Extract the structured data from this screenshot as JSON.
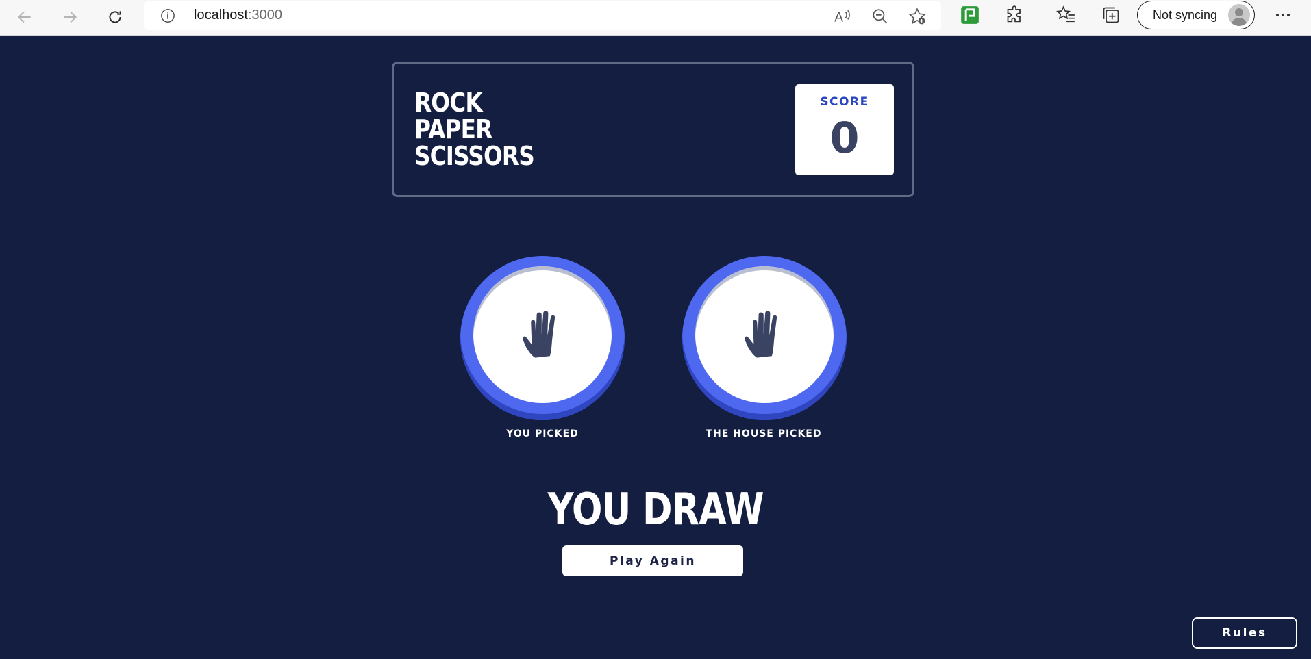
{
  "browser": {
    "url_host": "localhost",
    "url_port": ":3000",
    "profile_label": "Not syncing",
    "icons": [
      "back-arrow-icon",
      "forward-arrow-icon",
      "refresh-icon",
      "site-info-icon",
      "read-aloud-icon",
      "zoom-out-icon",
      "add-favorite-icon",
      "extension-green-icon",
      "extensions-puzzle-icon",
      "favorites-icon",
      "collections-icon",
      "profile-avatar-icon",
      "more-menu-icon"
    ]
  },
  "game": {
    "title_lines": [
      "ROCK",
      "PAPER",
      "SCISSORS"
    ],
    "score_label": "SCORE",
    "score_value": "0",
    "player_label": "YOU PICKED",
    "house_label": "THE HOUSE PICKED",
    "player_choice_icon": "paper-hand-icon",
    "house_choice_icon": "paper-hand-icon",
    "result_text": "YOU DRAW",
    "play_again_label": "Play Again",
    "rules_label": "Rules"
  },
  "colors": {
    "background": "#131e40",
    "paper_ring": "#4e69f0",
    "score_label": "#2a46c0",
    "score_value": "#3b4363",
    "header_border": "#5f6b86"
  }
}
